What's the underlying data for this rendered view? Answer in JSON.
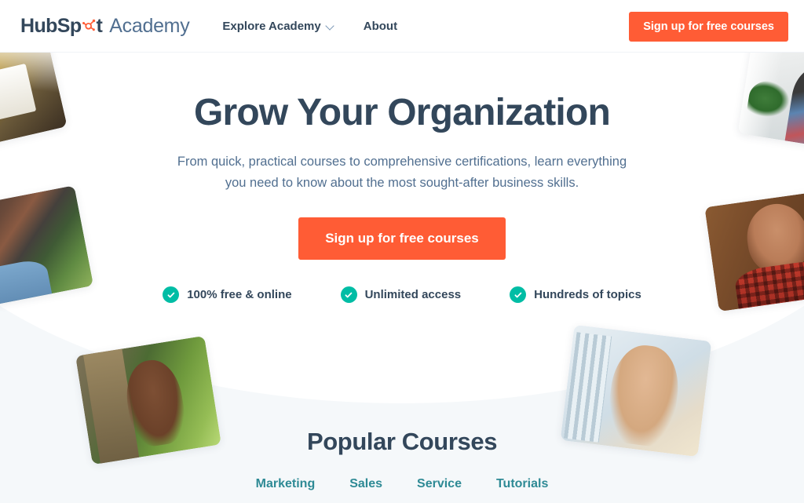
{
  "header": {
    "logo": {
      "brand": "HubSp",
      "brand_tail": "t",
      "product": "Academy",
      "sprocket_icon": "hubspot-sprocket-icon"
    },
    "nav": [
      {
        "label": "Explore Academy",
        "has_dropdown": true,
        "icon": "chevron-down-icon"
      },
      {
        "label": "About",
        "has_dropdown": false
      }
    ],
    "cta_label": "Sign up for free courses"
  },
  "hero": {
    "title": "Grow Your Organization",
    "subtitle": "From quick, practical courses to comprehensive certifications, learn everything you need to know about the most sought-after business skills.",
    "cta_label": "Sign up for free courses",
    "features": [
      {
        "label": "100% free & online",
        "icon": "check-circle-icon"
      },
      {
        "label": "Unlimited access",
        "icon": "check-circle-icon"
      },
      {
        "label": "Hundreds of topics",
        "icon": "check-circle-icon"
      }
    ]
  },
  "courses": {
    "title": "Popular Courses",
    "tabs": [
      {
        "label": "Marketing"
      },
      {
        "label": "Sales"
      },
      {
        "label": "Service"
      },
      {
        "label": "Tutorials"
      }
    ]
  },
  "decorations": [
    {
      "name": "photo-tile-top-left",
      "description": "warm-toned interior photo"
    },
    {
      "name": "photo-tile-top-right",
      "description": "person with plant photo"
    },
    {
      "name": "photo-tile-left",
      "description": "smiling man in blue shirt with greenery"
    },
    {
      "name": "photo-tile-right",
      "description": "bearded man in red plaid shirt on wood background"
    },
    {
      "name": "photo-tile-bottom-left",
      "description": "smiling woman outdoors with trees"
    },
    {
      "name": "photo-tile-bottom-right",
      "description": "man with glasses in light blue shirt"
    }
  ],
  "colors": {
    "brand_orange": "#ff5c35",
    "navy_text": "#33475b",
    "muted_text": "#516f90",
    "teal_accent": "#00bda5",
    "link_teal": "#2e8a95",
    "section_bg": "#f5f8fa",
    "page_bg": "#ffffff"
  }
}
